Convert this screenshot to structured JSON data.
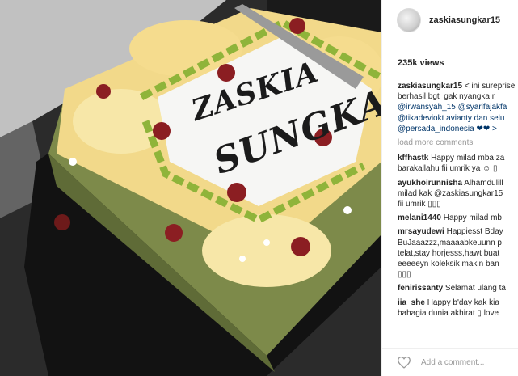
{
  "photo": {
    "cake_text_line1": "ZASKIA",
    "cake_text_line2": "SUNGKAR"
  },
  "post": {
    "username": "zaskiasungkar15",
    "views": "235k views",
    "caption": {
      "user": "zaskiasungkar15",
      "lines": [
        "< ini sureprise",
        "berhasil bgt ⁣ gak nyangka r",
        "@irwansyah_15 @syarifajakfa",
        "@tikadeviokt avianty dan selu",
        "@persada_indonesia ❤❤ >"
      ]
    },
    "load_more": "load more comments",
    "comments": [
      {
        "user": "kffhastk",
        "lines": [
          "Happy milad mba za",
          "barakallahu fii umrik ya ☺ ▯"
        ]
      },
      {
        "user": "ayukhoirunnisha",
        "lines": [
          "Alhamdulill",
          "milad kak @zaskiasungkar15",
          "fii umrik ▯▯▯"
        ]
      },
      {
        "user": "melani1440",
        "lines": [
          "Happy milad mb"
        ]
      },
      {
        "user": "mrsayudewi",
        "lines": [
          "Happiesst Bday",
          "BuJaaazzz,maaaabkeuunn p",
          "telat,stay horjesss,hawt buat",
          "eeeeeyn koleksik makin ban",
          "▯▯▯"
        ]
      },
      {
        "user": "fenirissanty",
        "lines": [
          "Selamat ulang ta"
        ]
      },
      {
        "user": "iia_she",
        "lines": [
          "Happy b'day kak kia",
          "bahagia dunia akhirat ▯ love"
        ]
      }
    ],
    "add_comment_placeholder": "Add a comment..."
  },
  "colors": {
    "mention": "#003569",
    "muted": "#999999",
    "text": "#262626",
    "border": "#efefef"
  },
  "icons": {
    "like": "heart-icon"
  }
}
